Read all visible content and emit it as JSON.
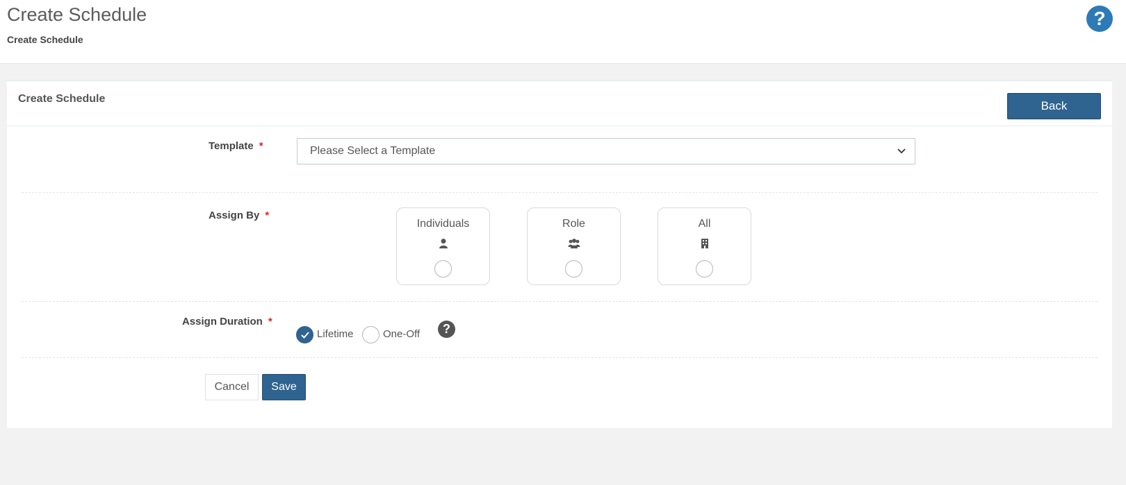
{
  "header": {
    "title": "Create Schedule",
    "subtitle": "Create Schedule",
    "help_icon": "question-circle-icon",
    "help_glyph": "?"
  },
  "panel": {
    "title": "Create Schedule",
    "back_label": "Back"
  },
  "form": {
    "template": {
      "label": "Template",
      "required_mark": "*",
      "selected": "Please Select a Template"
    },
    "assign_by": {
      "label": "Assign By",
      "required_mark": "*",
      "options": [
        {
          "label": "Individuals",
          "icon": "user-icon",
          "selected": false
        },
        {
          "label": "Role",
          "icon": "users-icon",
          "selected": false
        },
        {
          "label": "All",
          "icon": "building-icon",
          "selected": false
        }
      ]
    },
    "assign_duration": {
      "label": "Assign Duration",
      "required_mark": "*",
      "options": [
        {
          "label": "Lifetime",
          "selected": true
        },
        {
          "label": "One-Off",
          "selected": false
        }
      ],
      "help_glyph": "?"
    }
  },
  "actions": {
    "cancel_label": "Cancel",
    "save_label": "Save"
  },
  "colors": {
    "primary": "#2f6390",
    "help_blue": "#2d7ab6",
    "required": "#e02222",
    "background": "#f2f2f2"
  }
}
